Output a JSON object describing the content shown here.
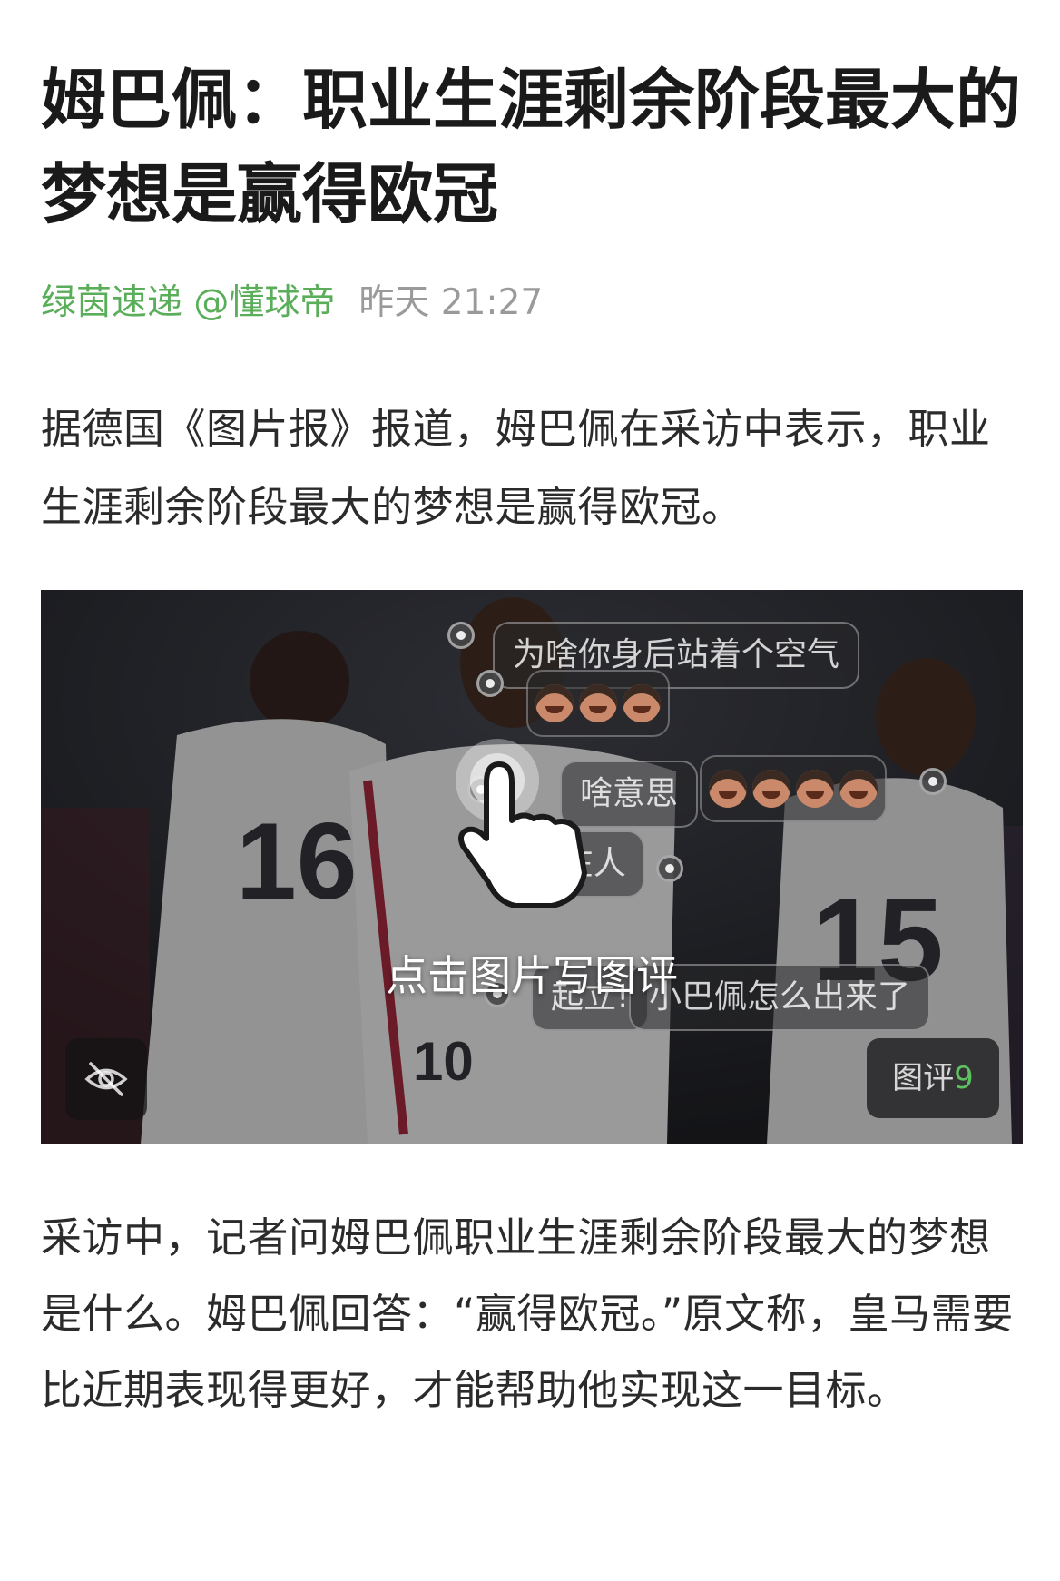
{
  "article": {
    "title": "姆巴佩：职业生涯剩余阶段最大的梦想是赢得欧冠",
    "source": "绿茵速递 @懂球帝",
    "time": "昨天 21:27",
    "paragraph1": "据德国《图片报》报道，姆巴佩在采访中表示，职业生涯剩余阶段最大的梦想是赢得欧冠。",
    "paragraph2": "采访中，记者问姆巴佩职业生涯剩余阶段最大的梦想是什么。姆巴佩回答：“赢得欧冠。”原文称，皇马需要比近期表现得更好，才能帮助他实现这一目标。"
  },
  "image": {
    "tap_hint": "点击图片写图评",
    "danmaku": [
      "为啥你身后站着个空气",
      "啥意思",
      "4号在人",
      "起立!",
      "小巴佩怎么出来了"
    ],
    "comments_label": "图评",
    "comments_count": "9",
    "jersey_numbers": [
      "16",
      "10",
      "15"
    ],
    "hide_icon": "eye-slash-icon",
    "hand_icon": "tap-hand-icon"
  },
  "colors": {
    "source": "#5aae5a",
    "time": "#9a9a9a",
    "comment_count": "#5fc05f"
  }
}
